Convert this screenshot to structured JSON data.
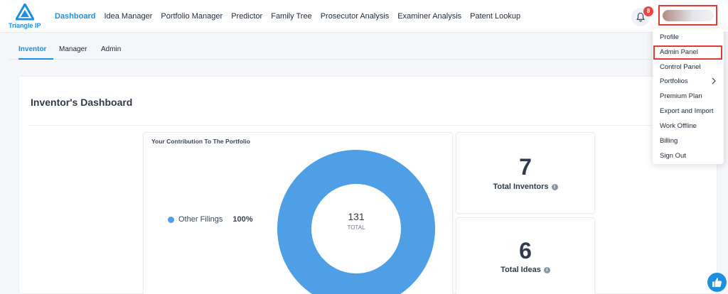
{
  "header": {
    "logo_text": "Triangle IP",
    "nav": [
      "Dashboard",
      "Idea Manager",
      "Portfolio Manager",
      "Predictor",
      "Family Tree",
      "Prosecutor Analysis",
      "Examiner Analysis",
      "Patent Lookup"
    ],
    "notification_count": "8"
  },
  "tabs": [
    "Inventor",
    "Manager",
    "Admin"
  ],
  "dashboard": {
    "title": "Inventor's Dashboard",
    "contribution": {
      "title": "Your Contribution To The Portfolio",
      "legend_label": "Other Filings",
      "legend_percent": "100%",
      "total_value": "131",
      "total_label": "TOTAL"
    },
    "stats": [
      {
        "value": "7",
        "label": "Total Inventors"
      },
      {
        "value": "6",
        "label": "Total Ideas"
      }
    ]
  },
  "user_menu": {
    "items": [
      "Profile",
      "Admin Panel",
      "Control Panel",
      "Portfolios",
      "Premium Plan",
      "Export and Import",
      "Work Offline",
      "Billing",
      "Sign Out"
    ]
  },
  "colors": {
    "accent": "#1d8fe1",
    "donut": "#4e9fe5",
    "highlight": "#e53935"
  }
}
